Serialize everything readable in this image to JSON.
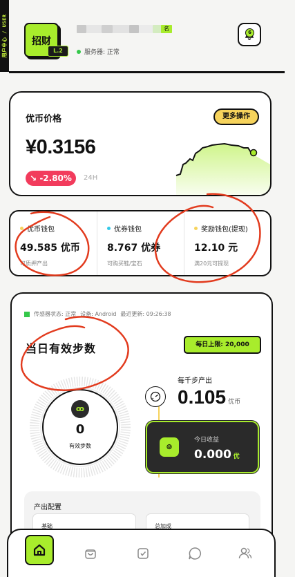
{
  "sidebar": {
    "tab_label": "用户中心 / USER"
  },
  "header": {
    "logo_text": "招财",
    "level": "L.2",
    "name_badge": "名",
    "server_status": "服务器: 正常",
    "notification_count": "6"
  },
  "price_card": {
    "title": "优币价格",
    "more_button": "更多操作",
    "price": "¥0.3156",
    "change": "-2.80%",
    "period": "24H"
  },
  "wallets": [
    {
      "label": "优币钱包",
      "value": "49.585 优币",
      "sub": "可质押产出",
      "dot_color": "#f6d35c"
    },
    {
      "label": "优券钱包",
      "value": "8.767 优券",
      "sub": "可购买鞋/宝石",
      "dot_color": "#33c9e8"
    },
    {
      "label": "奖励钱包(提现)",
      "value": "12.10 元",
      "sub": "满20元可提现",
      "dot_color": "#f6d35c"
    }
  ],
  "steps_card": {
    "sensor_status": "传感器状态: 正常",
    "device": "设备: Android",
    "last_update": "最近更新: 09:26:38",
    "title": "当日有效步数",
    "daily_limit": "每日上限: 20,000",
    "step_count": "0",
    "step_label": "有效步数",
    "per_thousand_label": "每千步产出",
    "per_thousand_value": "0.105",
    "per_thousand_unit": "优币",
    "today_earn_label": "今日收益",
    "today_earn_value": "0.000",
    "today_earn_unit": "优",
    "config_title": "产出配置",
    "config_base": "基础",
    "config_total": "总加成"
  },
  "colors": {
    "accent": "#a8ec2c",
    "dark": "#2a2a2a",
    "negative": "#f23b5c",
    "gold": "#f6d35c"
  },
  "nav": {
    "icons": [
      "home-icon",
      "bag-icon",
      "check-icon",
      "chat-icon",
      "users-icon"
    ]
  }
}
